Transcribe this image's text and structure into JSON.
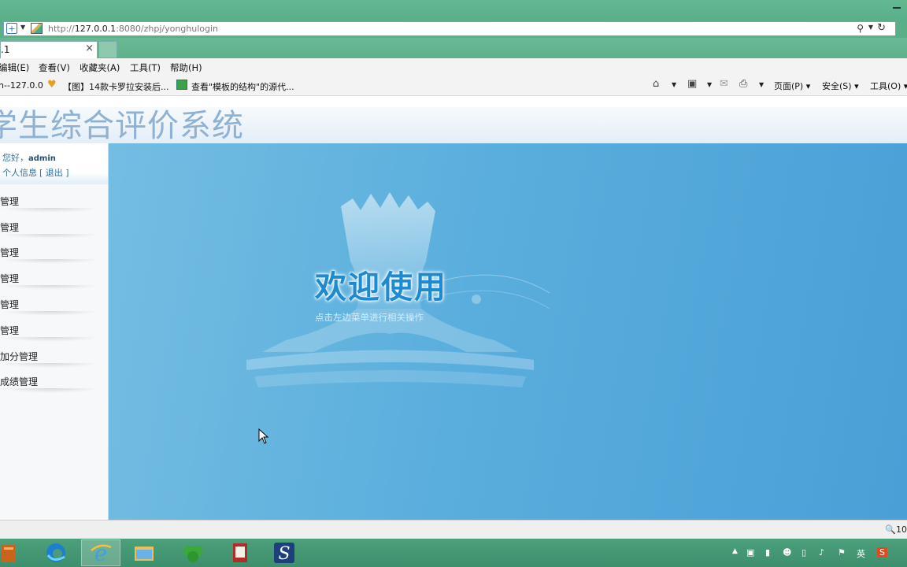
{
  "browser": {
    "url_prefix": "http://",
    "url_host": "127.0.0.1",
    "url_rest": ":8080/zhpj/yonghulogin",
    "tab_title": ".1",
    "menu": [
      "编辑(E)",
      "查看(V)",
      "收藏夹(A)",
      "工具(T)",
      "帮助(H)"
    ],
    "favorites": [
      "n--127.0.0",
      "【图】14款卡罗拉安装后...",
      "查看\"模板的结构\"的源代..."
    ],
    "tools": [
      "页面(P)",
      "安全(S)",
      "工具(O)"
    ],
    "zoom": "10"
  },
  "site": {
    "title": "学生综合评价系统"
  },
  "sidebar": {
    "greeting": "您好，",
    "username": "admin",
    "profile_link": "个人信息",
    "logout_link": "[ 退出 ]",
    "items": [
      {
        "label": "管理"
      },
      {
        "label": "管理"
      },
      {
        "label": "管理"
      },
      {
        "label": "管理"
      },
      {
        "label": "管理"
      },
      {
        "label": "管理"
      },
      {
        "label": "加分管理"
      },
      {
        "label": "成绩管理"
      }
    ]
  },
  "main": {
    "welcome": "欢迎使用",
    "subtitle": "点击左边菜单进行相关操作"
  },
  "taskbar": {
    "ime": "英"
  }
}
